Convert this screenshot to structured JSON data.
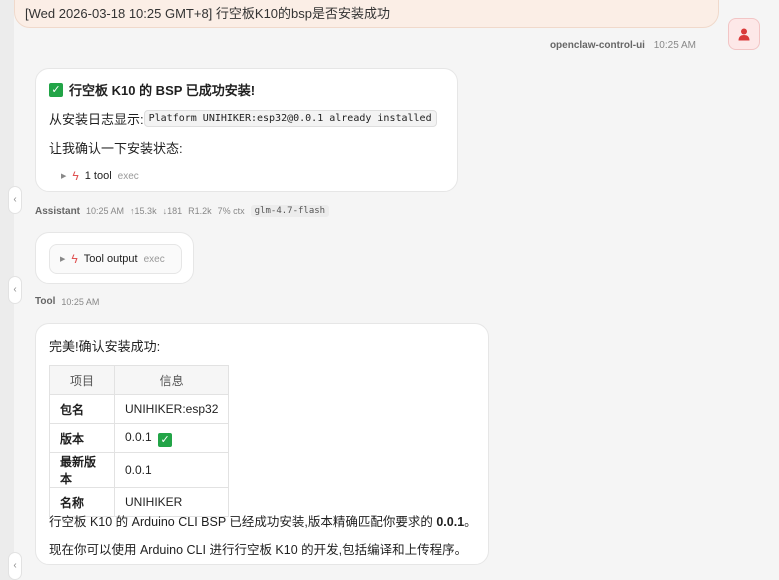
{
  "user_message": {
    "text": "[Wed 2026-03-18 10:25 GMT+8] 行空板K10的bsp是否安装成功",
    "sender": "openclaw-control-ui",
    "time": "10:25 AM"
  },
  "assistant_message": {
    "title": "行空板 K10 的 BSP 已成功安装!",
    "log_label": "从安装日志显示:",
    "log_code": "Platform UNIHIKER:esp32@0.0.1 already installed",
    "confirm_text": "让我确认一下安装状态:",
    "tool_summary": "1 tool",
    "tool_kind": "exec"
  },
  "assistant_meta": {
    "sender": "Assistant",
    "time": "10:25 AM",
    "tokens_in": "↑15.3k",
    "tokens_out": "↓181",
    "cache": "R1.2k",
    "ctx": "7% ctx",
    "model": "glm-4.7-flash"
  },
  "tool_message": {
    "label": "Tool output",
    "kind": "exec"
  },
  "tool_meta": {
    "sender": "Tool",
    "time": "10:25 AM"
  },
  "final_message": {
    "intro": "完美!确认安装成功:",
    "table_headers": [
      "项目",
      "信息"
    ],
    "table_rows": [
      {
        "key": "包名",
        "value": "UNIHIKER:esp32"
      },
      {
        "key": "版本",
        "value": "0.0.1"
      },
      {
        "key": "最新版本",
        "value": "0.0.1"
      },
      {
        "key": "名称",
        "value": "UNIHIKER"
      }
    ],
    "para1_prefix": "行空板 K10 的 Arduino CLI BSP 已经成功安装,版本精确匹配你要求的 ",
    "para1_bold": "0.0.1",
    "para1_suffix": "。",
    "para2": "现在你可以使用 Arduino CLI 进行行空板 K10 的开发,包括编译和上传程序。"
  },
  "colors": {
    "user_bubble": "#fbeee6",
    "accent_red": "#e05252",
    "check_green": "#22a447"
  },
  "icons": [
    "user-icon",
    "check-icon",
    "bolt-icon",
    "caret-icon"
  ]
}
